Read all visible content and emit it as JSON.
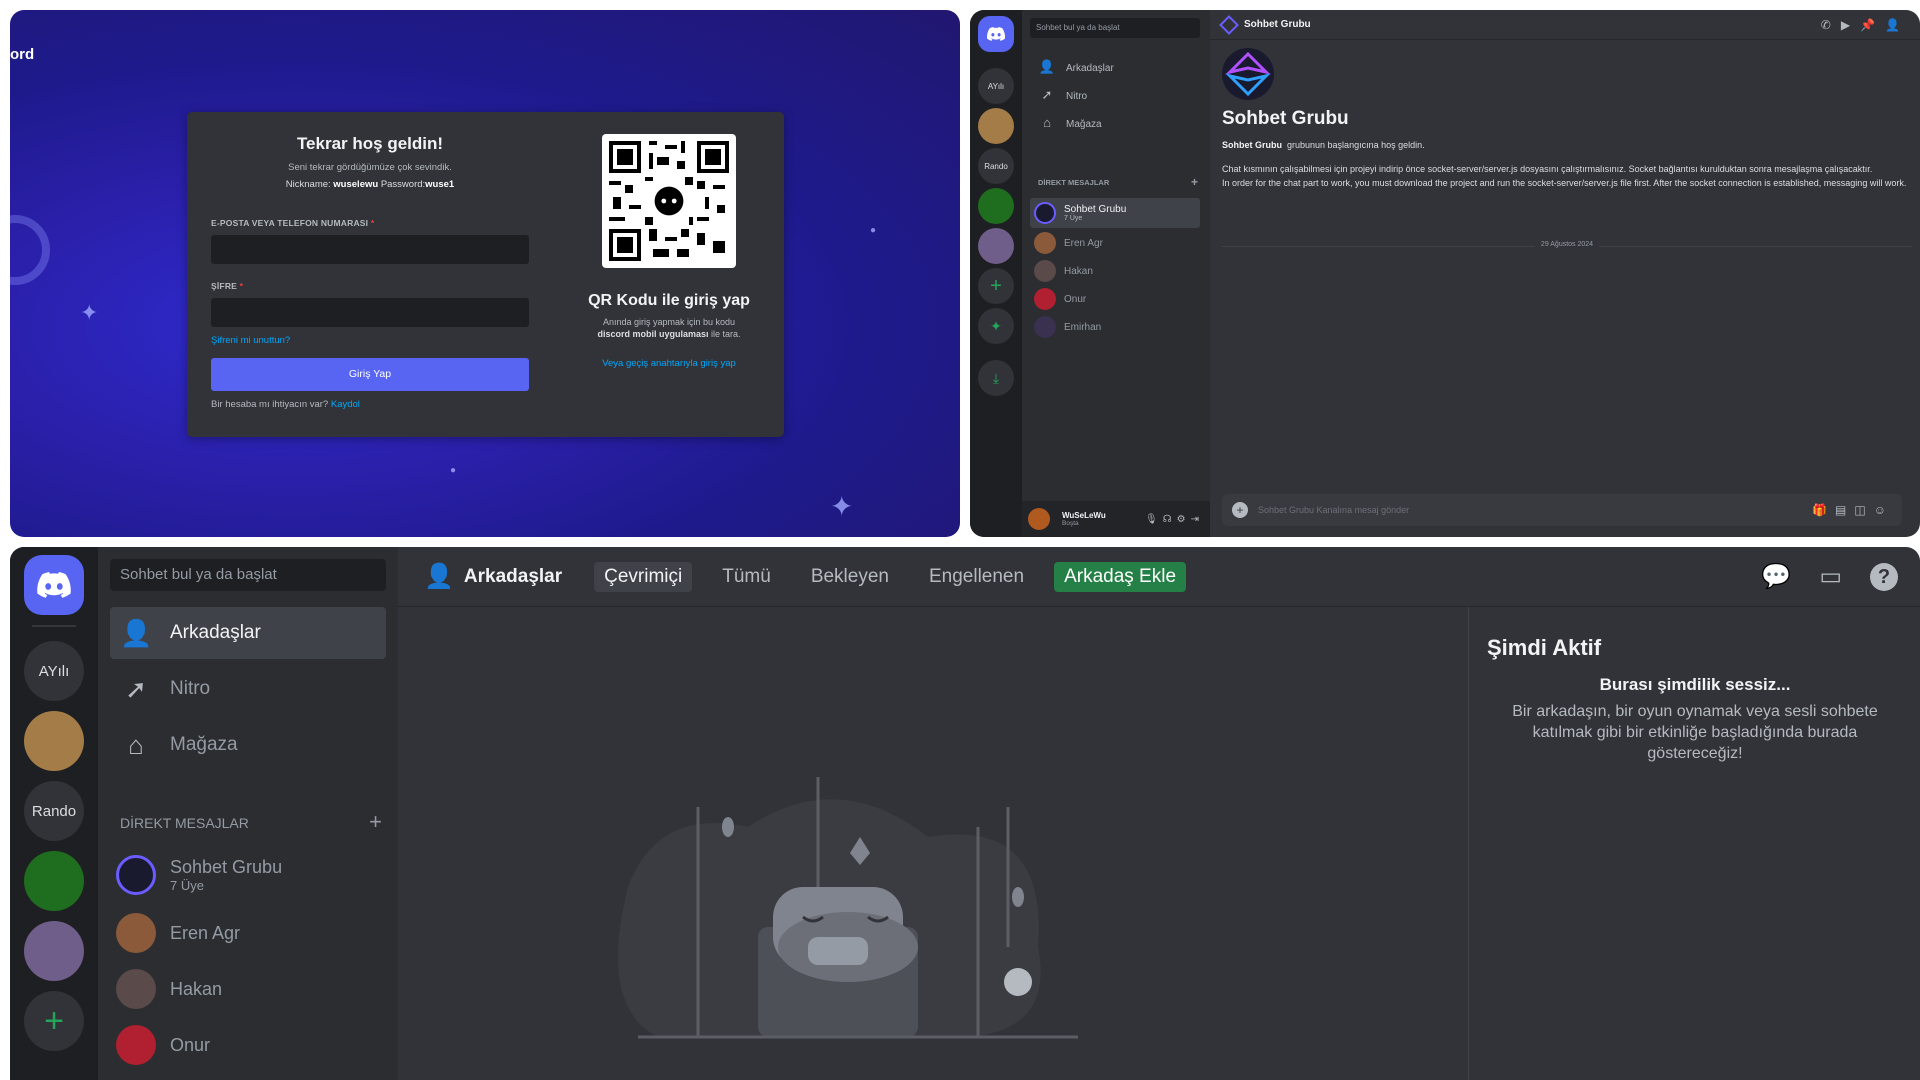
{
  "login": {
    "brand": "ord",
    "title": "Tekrar hoş geldin!",
    "subtitle": "Seni tekrar gördüğümüze çok sevindik.",
    "nick_label": "Nickname:",
    "nick_value": "wuselewu",
    "pass_label": "Password:",
    "pass_value": "wuse1",
    "email_label": "E-POSTA VEYA TELEFON NUMARASI",
    "password_label": "ŞİFRE",
    "required_mark": "*",
    "forgot": "Şifreni mi unuttun?",
    "login_button": "Giriş Yap",
    "register_prompt": "Bir hesaba mı ihtiyacın var?",
    "register_link": "Kaydol",
    "qr_title": "QR Kodu ile giriş yap",
    "qr_sub_1": "Anında giriş yapmak için bu kodu",
    "qr_sub_bold": "discord mobil uygulaması",
    "qr_sub_2": "ile tara.",
    "passkey_link": "Veya geçiş anahtarıyla giriş yap"
  },
  "chat": {
    "search_placeholder": "Sohbet bul ya da başlat",
    "servers": [
      "AYılı",
      "Rando"
    ],
    "nav": [
      "Arkadaşlar",
      "Nitro",
      "Mağaza"
    ],
    "dm_header": "DİREKT MESAJLAR",
    "dms": [
      {
        "name": "Sohbet Grubu",
        "sub": "7 Üye"
      },
      {
        "name": "Eren Agr"
      },
      {
        "name": "Hakan"
      },
      {
        "name": "Onur"
      },
      {
        "name": "Emirhan"
      }
    ],
    "user_name": "WuSeLeWu",
    "user_status": "Boşta",
    "header_title": "Sohbet Grubu",
    "big_title": "Sohbet Grubu",
    "welcome_bold": "Sohbet Grubu",
    "welcome_rest": "grubunun başlangıcına hoş geldin.",
    "desc_tr": "Chat kısmının çalışabilmesi için projeyi indirip önce socket-server/server.js dosyasını çalıştırmalısınız. Socket bağlantısı kurulduktan sonra mesajlaşma çalışacaktır.",
    "desc_en": "In order for the chat part to work, you must download the project and run the socket-server/server.js file first. After the socket connection is established, messaging will work.",
    "date_divider": "29 Ağustos 2024",
    "message_placeholder": "Sohbet Grubu Kanalına mesaj gönder"
  },
  "friends": {
    "search_placeholder": "Sohbet bul ya da başlat",
    "servers": [
      "AYılı",
      "Rando"
    ],
    "nav": [
      "Arkadaşlar",
      "Nitro",
      "Mağaza"
    ],
    "dm_header": "DİREKT MESAJLAR",
    "dms": [
      {
        "name": "Sohbet Grubu",
        "sub": "7 Üye"
      },
      {
        "name": "Eren Agr"
      },
      {
        "name": "Hakan"
      },
      {
        "name": "Onur"
      }
    ],
    "header_title": "Arkadaşlar",
    "tabs": [
      "Çevrimiçi",
      "Tümü",
      "Bekleyen",
      "Engellenen"
    ],
    "add_friend": "Arkadaş Ekle",
    "active_title": "Şimdi Aktif",
    "quiet_title": "Burası şimdilik sessiz...",
    "quiet_text": "Bir arkadaşın, bir oyun oynamak veya sesli sohbete katılmak gibi bir etkinliğe başladığında burada göstereceğiz!"
  },
  "colors": {
    "blurple": "#5865f2",
    "green": "#248046",
    "bg": "#313338",
    "sidebar": "#2b2d31",
    "rail": "#1e1f22"
  }
}
